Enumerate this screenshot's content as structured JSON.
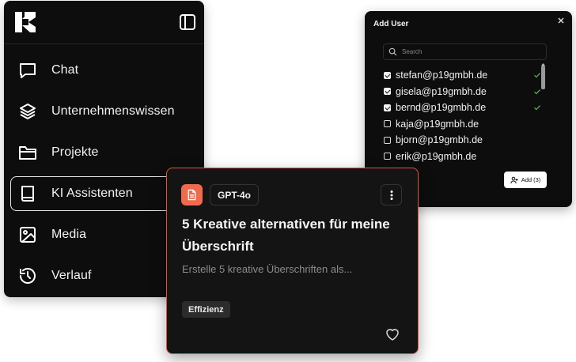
{
  "sidebar": {
    "logo_icon": "k-logo-icon",
    "toggle_icon": "panel-toggle-icon",
    "items": [
      {
        "label": "Chat",
        "icon": "chat-bubble-icon",
        "active": false
      },
      {
        "label": "Unternehmenswissen",
        "icon": "layers-icon",
        "active": false
      },
      {
        "label": "Projekte",
        "icon": "folder-icon",
        "active": false
      },
      {
        "label": "KI Assistenten",
        "icon": "book-icon",
        "active": true
      },
      {
        "label": "Media",
        "icon": "image-icon",
        "active": false
      },
      {
        "label": "Verlauf",
        "icon": "history-icon",
        "active": false
      }
    ]
  },
  "dialog": {
    "title": "Add User",
    "search_placeholder": "Search",
    "users": [
      {
        "email": "stefan@p19gmbh.de",
        "checked": true
      },
      {
        "email": "gisela@p19gmbh.de",
        "checked": true
      },
      {
        "email": "bernd@p19gmbh.de",
        "checked": true
      },
      {
        "email": "kaja@p19gmbh.de",
        "checked": false
      },
      {
        "email": "bjorn@p19gmbh.de",
        "checked": false
      },
      {
        "email": "erik@p19gmbh.de",
        "checked": false
      }
    ],
    "add_button_label": "Add (3)",
    "scroll_position": 0.0
  },
  "card": {
    "model": "GPT-4o",
    "title": "5 Kreative alternativen für meine Überschrift",
    "description": "Erstelle 5 kreative Überschriften als...",
    "tag": "Effizienz"
  },
  "colors": {
    "background": "#0d0d0d",
    "accent": "#f06a4d",
    "card_border": "#e0533d",
    "check_green": "#4caf50"
  }
}
